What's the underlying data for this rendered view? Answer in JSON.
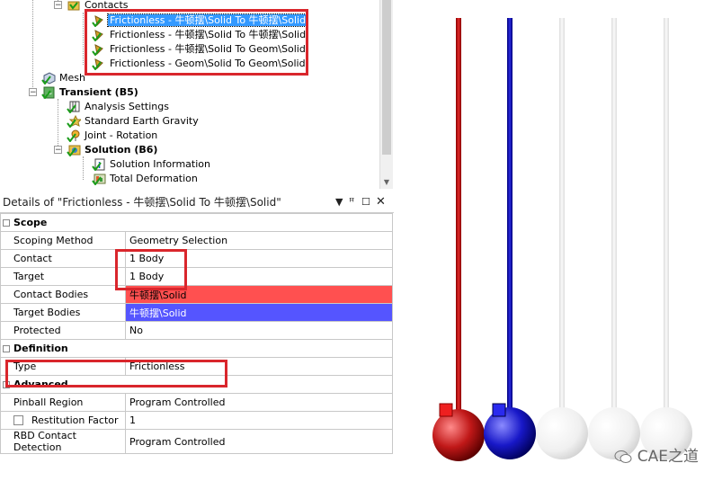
{
  "tree": {
    "contacts": "Contacts",
    "contact_items": [
      "Frictionless - 牛顿摆\\Solid To 牛顿摆\\Solid",
      "Frictionless - 牛顿摆\\Solid To 牛顿摆\\Solid",
      "Frictionless - 牛顿摆\\Solid To Geom\\Solid",
      "Frictionless - Geom\\Solid To Geom\\Solid"
    ],
    "mesh": "Mesh",
    "transient": "Transient (B5)",
    "analysis_settings": "Analysis Settings",
    "gravity": "Standard Earth Gravity",
    "joint": "Joint - Rotation",
    "solution": "Solution (B6)",
    "solution_info": "Solution Information",
    "total_deformation": "Total Deformation"
  },
  "details": {
    "title": "Details of \"Frictionless - 牛顿摆\\Solid To 牛顿摆\\Solid\"",
    "pin": "ꟸ",
    "sections": {
      "scope": "Scope",
      "definition": "Definition",
      "advanced": "Advanced"
    },
    "rows": {
      "scoping_method": {
        "k": "Scoping Method",
        "v": "Geometry Selection"
      },
      "contact": {
        "k": "Contact",
        "v": "1 Body"
      },
      "target": {
        "k": "Target",
        "v": "1 Body"
      },
      "contact_bodies": {
        "k": "Contact Bodies",
        "v": "牛顿摆\\Solid"
      },
      "target_bodies": {
        "k": "Target Bodies",
        "v": "牛顿摆\\Solid"
      },
      "protected": {
        "k": "Protected",
        "v": "No"
      },
      "type": {
        "k": "Type",
        "v": "Frictionless"
      },
      "pinball": {
        "k": "Pinball Region",
        "v": "Program Controlled"
      },
      "restitution": {
        "k": "Restitution Factor",
        "v": "1"
      },
      "rbd": {
        "k": "RBD Contact Detection",
        "v": "Program Controlled"
      }
    }
  },
  "watermark": "CAE之道",
  "colors": {
    "contact_bodies": "#ff5050",
    "target_bodies": "#5555ff",
    "selection": "#3399ff",
    "highlight_box": "#d9262c"
  }
}
